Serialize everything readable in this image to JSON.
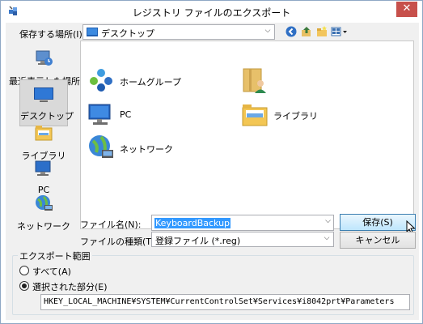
{
  "window": {
    "title": "レジストリ ファイルのエクスポート",
    "close_glyph": "✕"
  },
  "location": {
    "label": "保存する場所(I):",
    "value": "デスクトップ"
  },
  "places": [
    {
      "label": "最近表示した場所",
      "icon": "recent-places-icon"
    },
    {
      "label": "デスクトップ",
      "icon": "desktop-icon",
      "selected": true
    },
    {
      "label": "ライブラリ",
      "icon": "libraries-icon"
    },
    {
      "label": "PC",
      "icon": "pc-icon"
    },
    {
      "label": "ネットワーク",
      "icon": "network-icon"
    }
  ],
  "items": [
    {
      "name": "ホームグループ",
      "icon": "homegroup-icon"
    },
    {
      "name": "",
      "icon": "user-folder-icon"
    },
    {
      "name": "PC",
      "icon": "pc-icon"
    },
    {
      "name": "ライブラリ",
      "icon": "libraries-icon"
    },
    {
      "name": "ネットワーク",
      "icon": "network-icon"
    }
  ],
  "filename": {
    "label": "ファイル名(N):",
    "value": "KeyboardBackup"
  },
  "filetype": {
    "label": "ファイルの種類(T):",
    "value": "登録ファイル (*.reg)"
  },
  "buttons": {
    "save": "保存(S)",
    "cancel": "キャンセル"
  },
  "export_range": {
    "title": "エクスポート範囲",
    "all_label": "すべて(A)",
    "selected_label": "選択された部分(E)",
    "selected_checked": true,
    "key_path": "HKEY_LOCAL_MACHINE¥SYSTEM¥CurrentControlSet¥Services¥i8042prt¥Parameters"
  },
  "colors": {
    "accent": "#3399ff",
    "close": "#c7504b"
  }
}
